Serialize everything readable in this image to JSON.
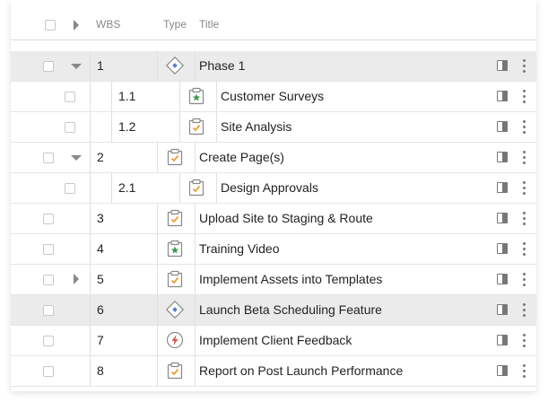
{
  "header": {
    "wbs_label": "WBS",
    "type_label": "Type",
    "title_label": "Title"
  },
  "rows": [
    {
      "wbs": "1",
      "title": "Phase 1",
      "type": "diamond-milestone-icon",
      "level": 0,
      "expander": "expanded",
      "highlight": true
    },
    {
      "wbs": "1.1",
      "title": "Customer Surveys",
      "type": "star-deliverable-icon",
      "level": 1,
      "expander": "none",
      "highlight": false
    },
    {
      "wbs": "1.2",
      "title": "Site Analysis",
      "type": "clipboard-task-icon",
      "level": 1,
      "expander": "none",
      "highlight": false
    },
    {
      "wbs": "2",
      "title": "Create Page(s)",
      "type": "clipboard-task-icon",
      "level": 0,
      "expander": "expanded",
      "highlight": false
    },
    {
      "wbs": "2.1",
      "title": "Design Approvals",
      "type": "clipboard-task-icon",
      "level": 1,
      "expander": "none",
      "highlight": false
    },
    {
      "wbs": "3",
      "title": "Upload Site to Staging & Route",
      "type": "clipboard-task-icon",
      "level": 0,
      "expander": "none",
      "highlight": false
    },
    {
      "wbs": "4",
      "title": "Training Video",
      "type": "star-deliverable-icon",
      "level": 0,
      "expander": "none",
      "highlight": false
    },
    {
      "wbs": "5",
      "title": "Implement Assets into Templates",
      "type": "clipboard-task-icon",
      "level": 0,
      "expander": "collapsed",
      "highlight": false
    },
    {
      "wbs": "6",
      "title": "Launch Beta Scheduling Feature",
      "type": "diamond-milestone-icon",
      "level": 0,
      "expander": "none",
      "highlight": true
    },
    {
      "wbs": "7",
      "title": "Implement Client Feedback",
      "type": "lightning-issue-icon",
      "level": 0,
      "expander": "none",
      "highlight": false
    },
    {
      "wbs": "8",
      "title": "Report on Post Launch Performance",
      "type": "clipboard-task-icon",
      "level": 0,
      "expander": "none",
      "highlight": false
    }
  ],
  "colors": {
    "task_orange": "#e8a13a",
    "star_green": "#3c9a4b",
    "milestone_blue": "#5a7fd0",
    "issue_red": "#d9534f",
    "row_highlight": "#ebebeb"
  }
}
